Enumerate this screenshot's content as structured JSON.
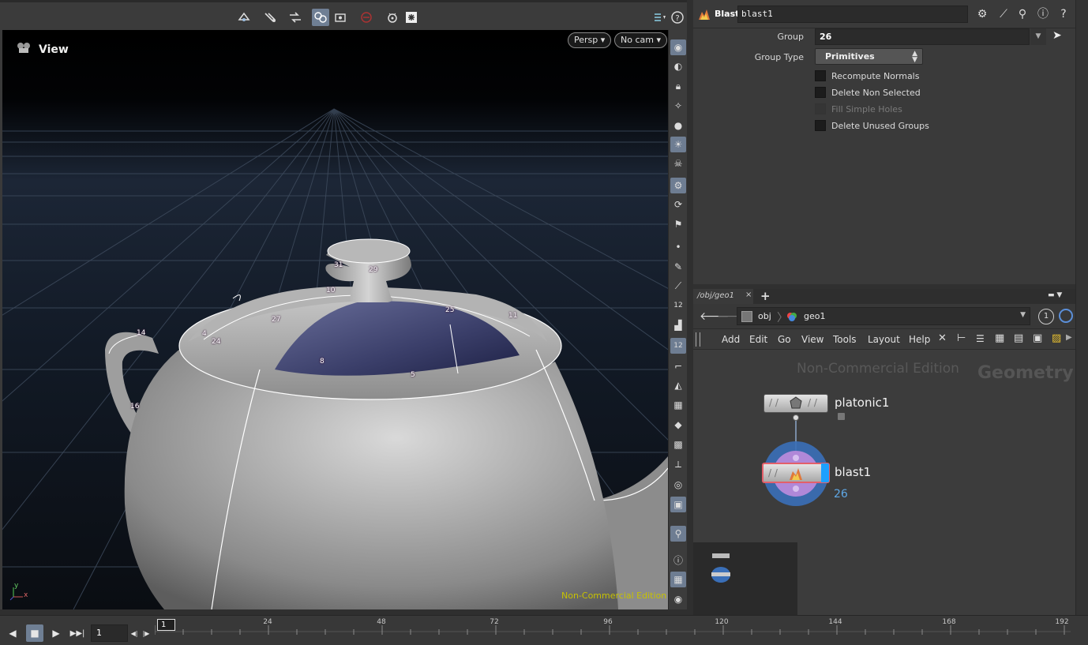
{
  "viewport": {
    "title": "View",
    "camera_mode": "Persp ▾",
    "camera": "No cam ▾",
    "watermark": "Non-Commercial Edition",
    "axis_x": "x",
    "axis_y": "y",
    "primitive_numbers": [
      "31",
      "29",
      "10",
      "27",
      "25",
      "11",
      "14",
      "4",
      "24",
      "8",
      "5",
      "16"
    ],
    "toolbar_icons": [
      "display-options-icon",
      "snapping-icon",
      "handles-icon",
      "ghost-icon",
      "camera-icon",
      "no-entry-icon",
      "pose-icon",
      "gear-render-icon"
    ],
    "strip_icons": [
      "show-all-icon",
      "visible-icon",
      "lock-icon",
      "template-icon",
      "shading-icon",
      "light-icon",
      "xray-icon",
      "display-icon",
      "select-icon",
      "brush-icon",
      "pencil-icon",
      "point-numbers-icon",
      "paint-icon",
      "primitive-numbers-icon",
      "normals-icon",
      "pin-icon",
      "uv-icon",
      "weight-icon",
      "grid-icon",
      "snap-icon",
      "cube-icon",
      "background-icon",
      "info-icon",
      "layout-icon",
      "eye-icon"
    ]
  },
  "parameters": {
    "node_type": "Blast",
    "node_name": "blast1",
    "group_label": "Group",
    "group_value": "26",
    "group_type_label": "Group Type",
    "group_type_value": "Primitives",
    "checkboxes": [
      {
        "label": "Recompute Normals",
        "checked": false,
        "enabled": true
      },
      {
        "label": "Delete Non Selected",
        "checked": false,
        "enabled": true
      },
      {
        "label": "Fill Simple Holes",
        "checked": false,
        "enabled": false
      },
      {
        "label": "Delete Unused Groups",
        "checked": false,
        "enabled": true
      }
    ]
  },
  "network": {
    "tab_label": "/obj/geo1",
    "tab_close": "×",
    "tab_add": "+",
    "path": [
      "obj",
      "geo1"
    ],
    "badge": "1",
    "menu": [
      "Add",
      "Edit",
      "Go",
      "View",
      "Tools",
      "Layout",
      "Help"
    ],
    "watermark": "Non-Commercial Edition",
    "context_label": "Geometry",
    "nodes": [
      {
        "name": "platonic1",
        "comment": ""
      },
      {
        "name": "blast1",
        "comment": "26"
      }
    ]
  },
  "timeline": {
    "current_frame": "1",
    "frame_field": "1",
    "ticks": [
      "24",
      "48",
      "72",
      "96",
      "120",
      "144",
      "168",
      "192"
    ],
    "buttons": [
      "prev-frame-icon",
      "stop-icon",
      "play-icon",
      "last-frame-icon"
    ]
  },
  "colors": {
    "accent": "#6f7f94",
    "node_blast_ring": "#3a6fb8",
    "node_blast_inner": "#b088d8",
    "comment_blue": "#5fa8e6",
    "watermark_yellow": "#c7c200"
  }
}
